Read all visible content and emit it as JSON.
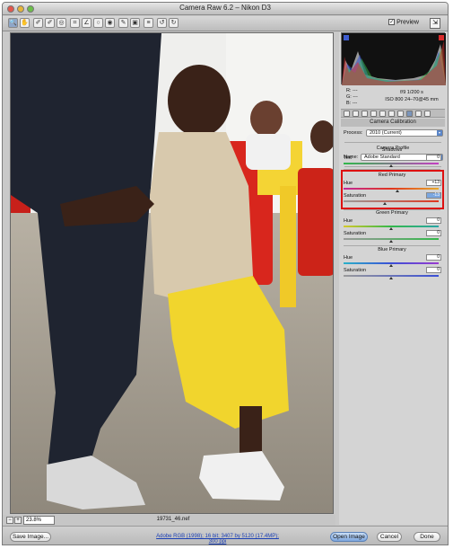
{
  "window": {
    "title": "Camera Raw 6.2  –  Nikon D3"
  },
  "toolbar": {
    "tools": [
      "zoom-tool",
      "hand-tool",
      "white-balance-tool",
      "color-sampler-tool",
      "targeted-adjustment-tool",
      "crop-tool",
      "straighten-tool",
      "spot-removal-tool",
      "red-eye-tool",
      "adjustment-brush",
      "graduated-filter",
      "preferences",
      "rotate-ccw",
      "rotate-cw"
    ],
    "preview_label": "Preview",
    "preview_checked": true
  },
  "image": {
    "zoom": "23.8%",
    "filename": "19731_46.nef"
  },
  "info": {
    "r": "R:",
    "g": "G:",
    "b": "B:",
    "r_val": "---",
    "g_val": "---",
    "b_val": "---",
    "aperture_shutter": "f/9   1/200 s",
    "iso_lens": "ISO 800   24–70@45 mm"
  },
  "panel": {
    "title": "Camera Calibration",
    "process_label": "Process:",
    "process_value": "2010 (Current)",
    "camera_profile_title": "Camera Profile",
    "name_label": "Name:",
    "name_value": "Adobe Standard",
    "shadows": {
      "title": "Shadows",
      "tint_label": "Tint",
      "tint_value": "0",
      "tint_level": 0.5
    },
    "red": {
      "title": "Red Primary",
      "hue_label": "Hue",
      "hue_value": "+13",
      "hue_level": 0.565,
      "sat_label": "Saturation",
      "sat_value": "-13",
      "sat_level": 0.435
    },
    "green": {
      "title": "Green Primary",
      "hue_label": "Hue",
      "hue_value": "0",
      "hue_level": 0.5,
      "sat_label": "Saturation",
      "sat_value": "0",
      "sat_level": 0.5
    },
    "blue": {
      "title": "Blue Primary",
      "hue_label": "Hue",
      "hue_value": "0",
      "hue_level": 0.5,
      "sat_label": "Saturation",
      "sat_value": "0",
      "sat_level": 0.5
    }
  },
  "footer": {
    "save_label": "Save Image...",
    "workflow_link": "Adobe RGB (1998); 16 bit; 3407 by 5120 (17.4MP); 300 ppi",
    "open_label": "Open Image",
    "cancel_label": "Cancel",
    "done_label": "Done"
  },
  "colors": {
    "highlight": "#dd1111",
    "accent": "#5b86c9"
  }
}
